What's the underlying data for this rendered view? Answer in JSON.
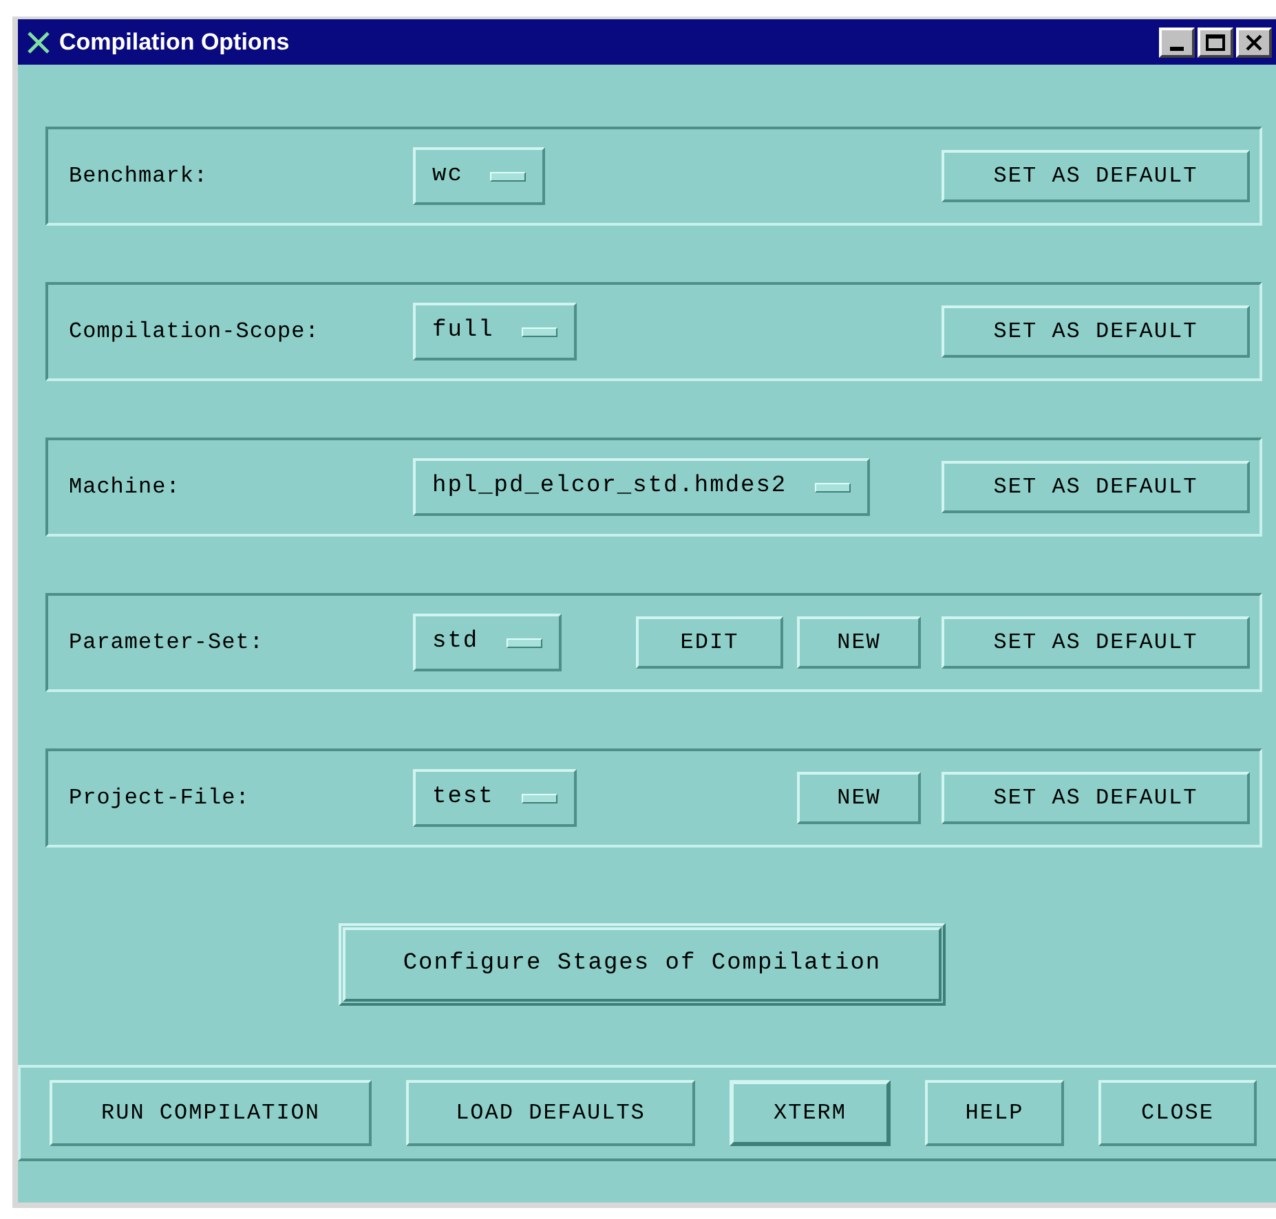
{
  "window": {
    "title": "Compilation Options"
  },
  "rows": [
    {
      "label": "Benchmark:",
      "value": "wc",
      "buttons": [
        {
          "label": "SET AS DEFAULT",
          "kind": "default"
        }
      ]
    },
    {
      "label": "Compilation-Scope:",
      "value": "full",
      "buttons": [
        {
          "label": "SET AS DEFAULT",
          "kind": "default"
        }
      ]
    },
    {
      "label": "Machine:",
      "value": "hpl_pd_elcor_std.hmdes2",
      "buttons": [
        {
          "label": "SET AS DEFAULT",
          "kind": "default"
        }
      ]
    },
    {
      "label": "Parameter-Set:",
      "value": "std",
      "buttons": [
        {
          "label": "EDIT",
          "kind": "edit"
        },
        {
          "label": "NEW",
          "kind": "new"
        },
        {
          "label": "SET AS DEFAULT",
          "kind": "default"
        }
      ]
    },
    {
      "label": "Project-File:",
      "value": "test",
      "buttons": [
        {
          "label": "NEW",
          "kind": "new"
        },
        {
          "label": "SET AS DEFAULT",
          "kind": "default"
        }
      ]
    }
  ],
  "configure_button": {
    "label": "Configure Stages of Compilation",
    "default": true
  },
  "footer_buttons": [
    {
      "label": "RUN COMPILATION",
      "default": false
    },
    {
      "label": "LOAD DEFAULTS",
      "default": false
    },
    {
      "label": "XTERM",
      "default": true
    },
    {
      "label": "HELP",
      "default": false
    },
    {
      "label": "CLOSE",
      "default": false
    }
  ]
}
